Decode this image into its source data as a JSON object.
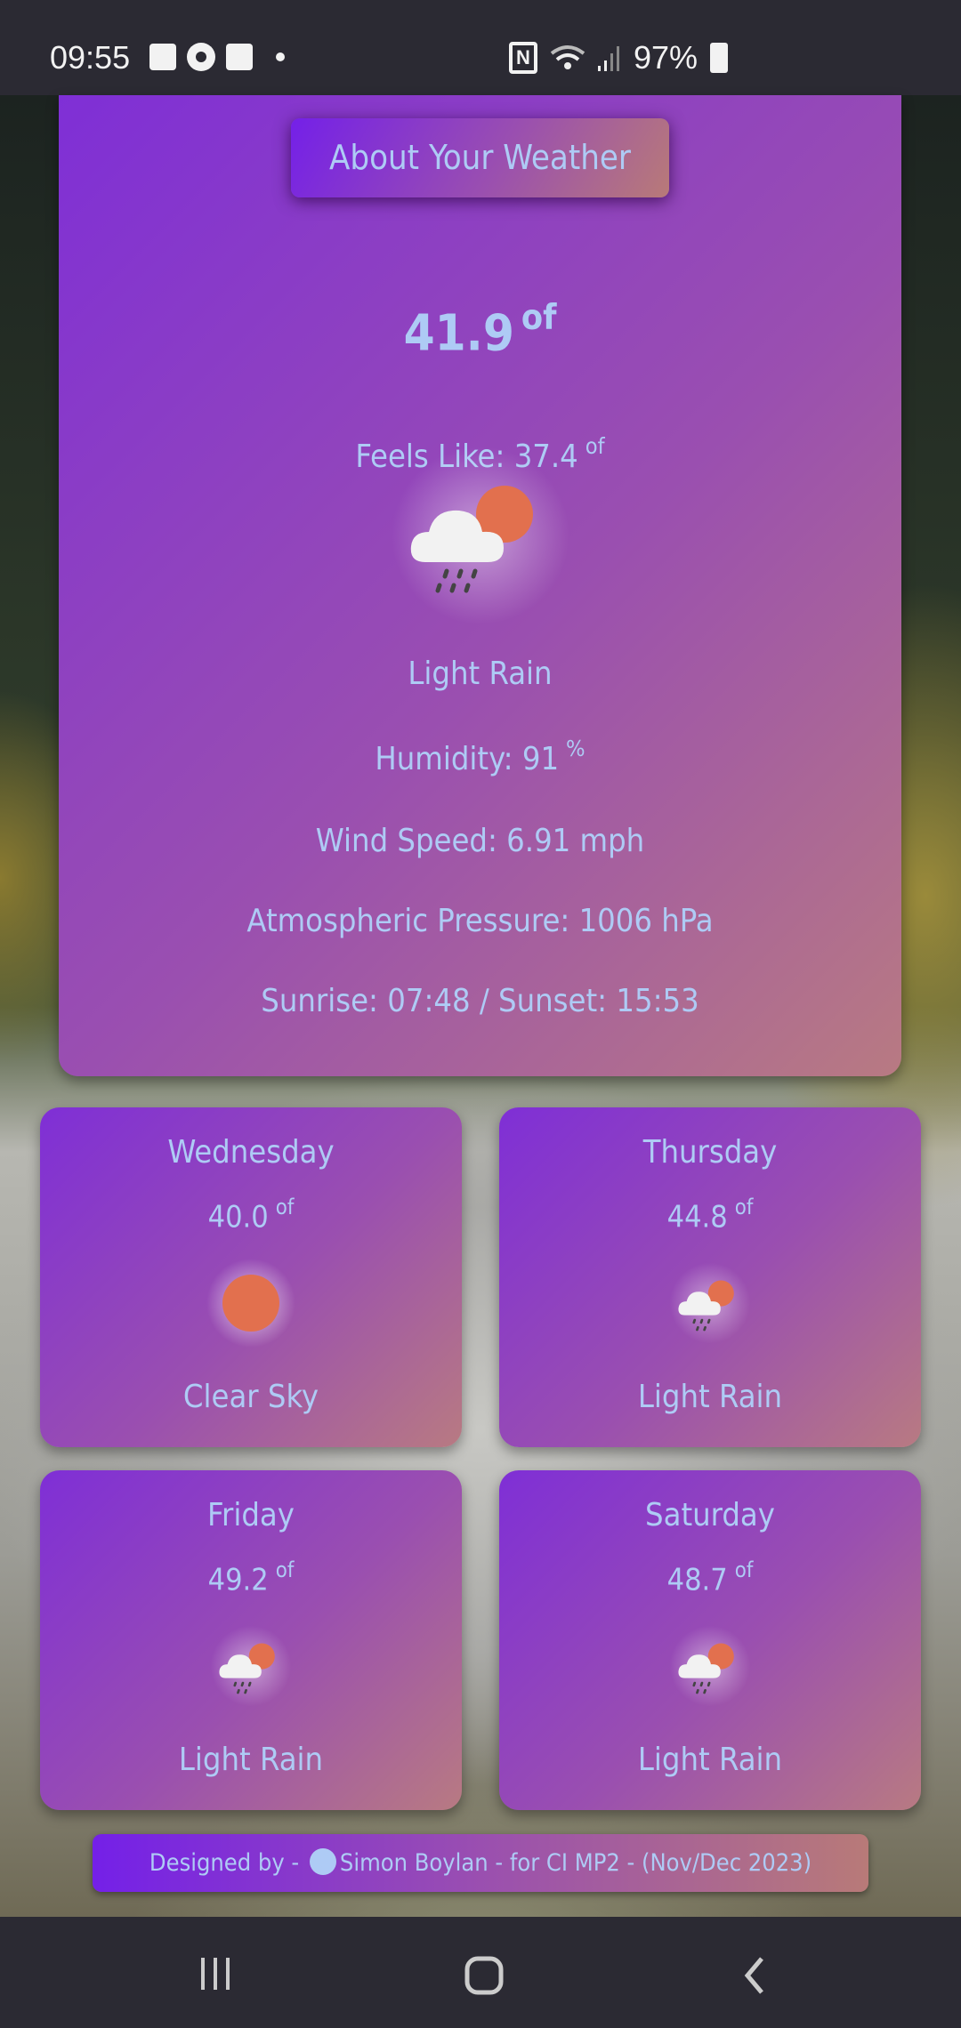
{
  "status_bar": {
    "time": "09:55",
    "battery": "97%",
    "icons": [
      "gallery-icon",
      "sync-icon",
      "mail-icon",
      "dot-icon",
      "nfc-icon",
      "wifi-icon",
      "signal-icon",
      "battery-icon"
    ]
  },
  "main": {
    "button": "About Your Weather",
    "temp": "41.9",
    "unit": "of",
    "feels_like_label": "Feels Like: 37.4",
    "feels_unit": "of",
    "icon": "cloud-sun-rain-icon",
    "description": "Light Rain",
    "humidity": "Humidity: 91",
    "humidity_unit": "%",
    "wind": "Wind Speed: 6.91 mph",
    "pressure": "Atmospheric Pressure: 1006 hPa",
    "sun": "Sunrise: 07:48 / Sunset: 15:53"
  },
  "forecast": [
    {
      "day": "Wednesday",
      "temp": "40.0",
      "unit": "of",
      "icon": "sun-icon",
      "desc": "Clear Sky"
    },
    {
      "day": "Thursday",
      "temp": "44.8",
      "unit": "of",
      "icon": "cloud-sun-rain-icon",
      "desc": "Light Rain"
    },
    {
      "day": "Friday",
      "temp": "49.2",
      "unit": "of",
      "icon": "cloud-sun-rain-icon",
      "desc": "Light Rain"
    },
    {
      "day": "Saturday",
      "temp": "48.7",
      "unit": "of",
      "icon": "cloud-sun-rain-icon",
      "desc": "Light Rain"
    }
  ],
  "footer": {
    "prefix": "Designed by -",
    "author": "Simon Boylan - for CI MP2 - (Nov/Dec 2023)"
  },
  "colors": {
    "text": "#aecbf5",
    "gradient_start": "#7420e8",
    "gradient_end": "#b87a78"
  }
}
